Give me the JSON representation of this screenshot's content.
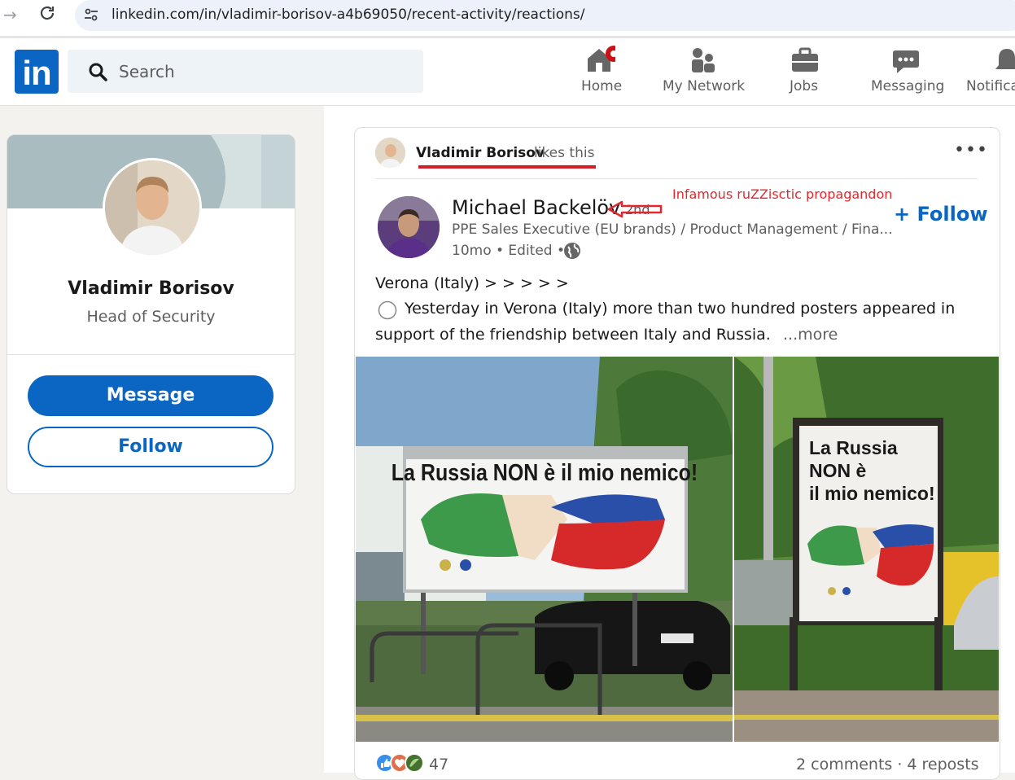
{
  "browser": {
    "url": "linkedin.com/in/vladimir-borisov-a4b69050/recent-activity/reactions/",
    "back_icon": "arrow-right-icon",
    "reload_icon": "reload-icon",
    "site_info_icon": "site-settings-icon"
  },
  "header": {
    "logo": "in",
    "search_placeholder": "Search",
    "nav": [
      {
        "label": "Home",
        "icon": "home-icon"
      },
      {
        "label": "My Network",
        "icon": "network-icon"
      },
      {
        "label": "Jobs",
        "icon": "briefcase-icon"
      },
      {
        "label": "Messaging",
        "icon": "chat-icon"
      },
      {
        "label": "Notifica",
        "icon": "bell-icon"
      }
    ]
  },
  "profile_card": {
    "name": "Vladimir Borisov",
    "title": "Head of Security",
    "message_label": "Message",
    "follow_label": "Follow"
  },
  "post": {
    "liker_name": "Vladimir Borisov",
    "liker_action": "likes this",
    "author_name": "Michael Backelöv",
    "author_degree": "2nd",
    "author_headline": "PPE Sales Executive (EU brands) / Product Management / Fina...",
    "meta": "10mo • Edited •",
    "follow_label": "+ Follow",
    "annotation": "Infamous ruZZisctic propagandon",
    "text_line1": "Verona (Italy) > > > > >",
    "text_line2": "Yesterday in Verona (Italy) more than two hundred posters appeared in",
    "text_line3": "support of the friendship between Italy and Russia.",
    "more_label": "...more",
    "billboard1_text": "La Russia NON è il mio nemico!",
    "billboard2_line1": "La Russia",
    "billboard2_line2": "NON è",
    "billboard2_line3": "il mio nemico!",
    "reaction_count": "47",
    "engagement": "2 comments · 4 reposts"
  },
  "colors": {
    "brand": "#0a66c2",
    "annotation_red": "#e0282e",
    "background": "#f4f2ee"
  }
}
